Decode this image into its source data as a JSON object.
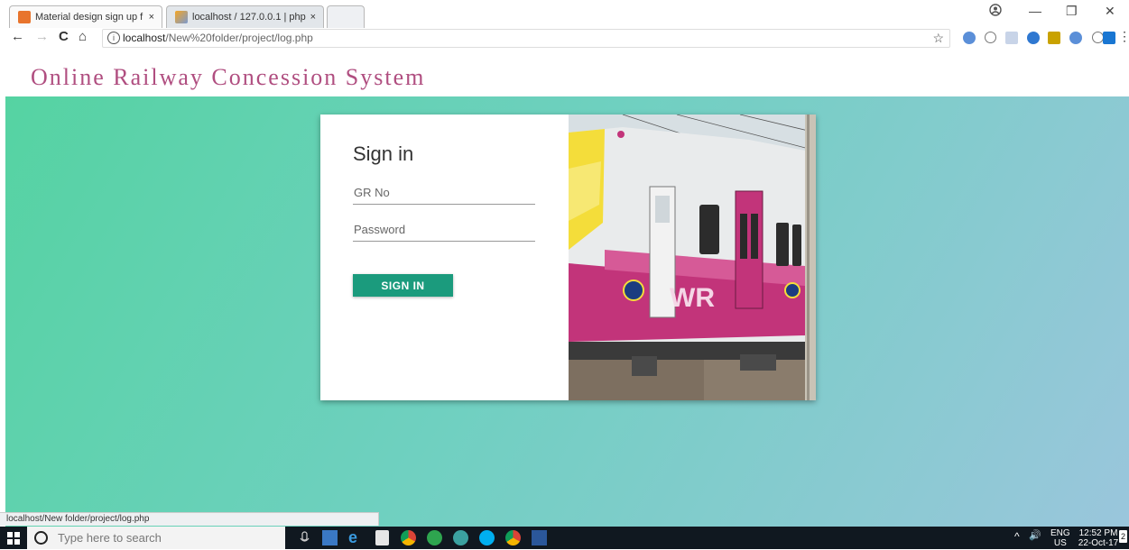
{
  "browser": {
    "tabs": [
      {
        "title": "Material design sign up f",
        "close": "×"
      },
      {
        "title": "localhost / 127.0.0.1 | php",
        "close": "×"
      }
    ],
    "url_host": "localhost",
    "url_path": "/New%20folder/project/log.php",
    "info_glyph": "i",
    "status_url": "localhost/New folder/project/log.php",
    "window_controls": {
      "minimize": "—",
      "restore": "❐",
      "close": "✕"
    },
    "nav": {
      "back": "←",
      "forward": "→",
      "reload": "C",
      "home": "⌂"
    },
    "star": "☆",
    "menu": "⋮"
  },
  "page": {
    "site_title": "Online Railway Concession System",
    "signin_heading": "Sign in",
    "gr_placeholder": "GR No",
    "password_placeholder": "Password",
    "signin_button": "SIGN IN",
    "train_logo_text": "WR"
  },
  "taskbar": {
    "search_placeholder": "Type here to search",
    "language": "ENG",
    "region": "US",
    "time": "12:52 PM",
    "date": "22-Oct-17",
    "tray_chevron": "^",
    "volume": "🔊",
    "notification_count": "2"
  },
  "colors": {
    "title": "#b04e80",
    "button": "#1b9b7d",
    "gradient_start": "#55d3a2",
    "gradient_end": "#9ac6dc"
  }
}
